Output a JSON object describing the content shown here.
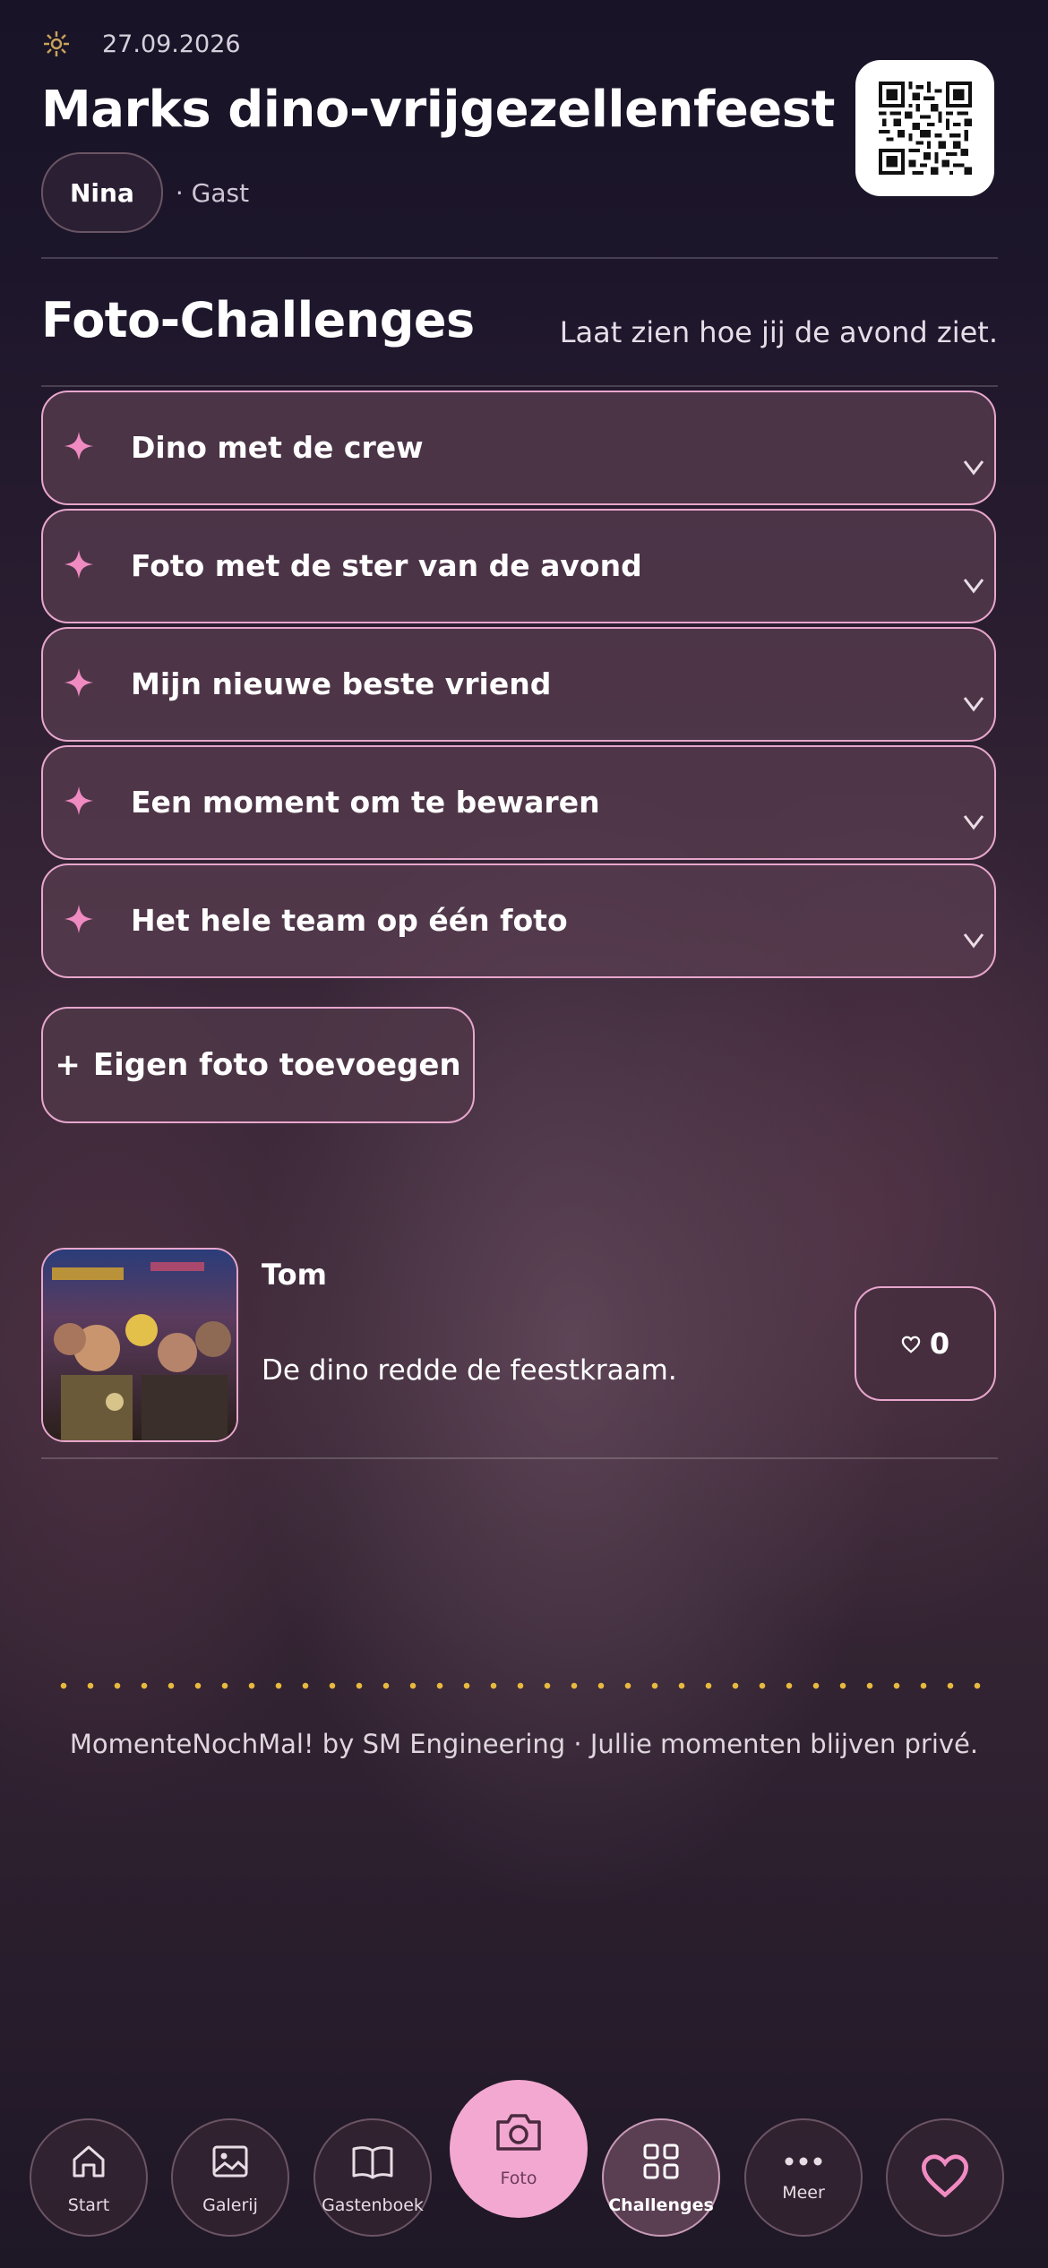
{
  "header": {
    "date": "27.09.2026",
    "title": "Marks dino-vrijgezellenfeest",
    "user_name": "Nina",
    "user_role": "· Gast"
  },
  "section": {
    "title": "Foto-Challenges",
    "subtitle": "Laat zien hoe jij de avond ziet."
  },
  "challenges": [
    {
      "label": "Dino met de crew"
    },
    {
      "label": "Foto met de ster van de avond"
    },
    {
      "label": "Mijn nieuwe beste vriend"
    },
    {
      "label": "Een moment om te bewaren"
    },
    {
      "label": "Het hele team op één foto"
    }
  ],
  "add_button": {
    "icon": "+",
    "label": "Eigen foto toevoegen"
  },
  "post": {
    "author": "Tom",
    "caption": "De dino redde de feestkraam.",
    "likes": "0"
  },
  "footer": {
    "text": "MomenteNochMal! by SM Engineering · Jullie momenten blijven privé."
  },
  "nav": {
    "start": "Start",
    "galerij": "Galerij",
    "gastenboek": "Gastenboek",
    "foto": "Foto",
    "challenges": "Challenges",
    "meer": "Meer"
  },
  "colors": {
    "accent_pink": "#f3a8d2",
    "border_pink": "#e7a6cc",
    "dots_gold": "#e8b93f"
  }
}
